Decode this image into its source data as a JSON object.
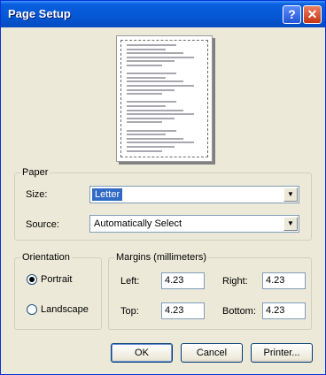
{
  "window": {
    "title": "Page Setup",
    "help_label": "?",
    "close_label": "✕"
  },
  "preview": {
    "line_widths": [
      56,
      44,
      64,
      76,
      54,
      40,
      0,
      56,
      44,
      64,
      76,
      54,
      40,
      0,
      56,
      44,
      64,
      76,
      54,
      40,
      0,
      56,
      44,
      64,
      76,
      54,
      40
    ]
  },
  "paper": {
    "group_label": "Paper",
    "size_label": "Size:",
    "size_value": "Letter",
    "source_label": "Source:",
    "source_value": "Automatically Select"
  },
  "orientation": {
    "group_label": "Orientation",
    "portrait_label": "Portrait",
    "landscape_label": "Landscape",
    "selected": "Portrait"
  },
  "margins": {
    "group_label": "Margins (millimeters)",
    "left_label": "Left:",
    "left_value": "4.23",
    "right_label": "Right:",
    "right_value": "4.23",
    "top_label": "Top:",
    "top_value": "4.23",
    "bottom_label": "Bottom:",
    "bottom_value": "4.23"
  },
  "buttons": {
    "ok": "OK",
    "cancel": "Cancel",
    "printer": "Printer..."
  }
}
